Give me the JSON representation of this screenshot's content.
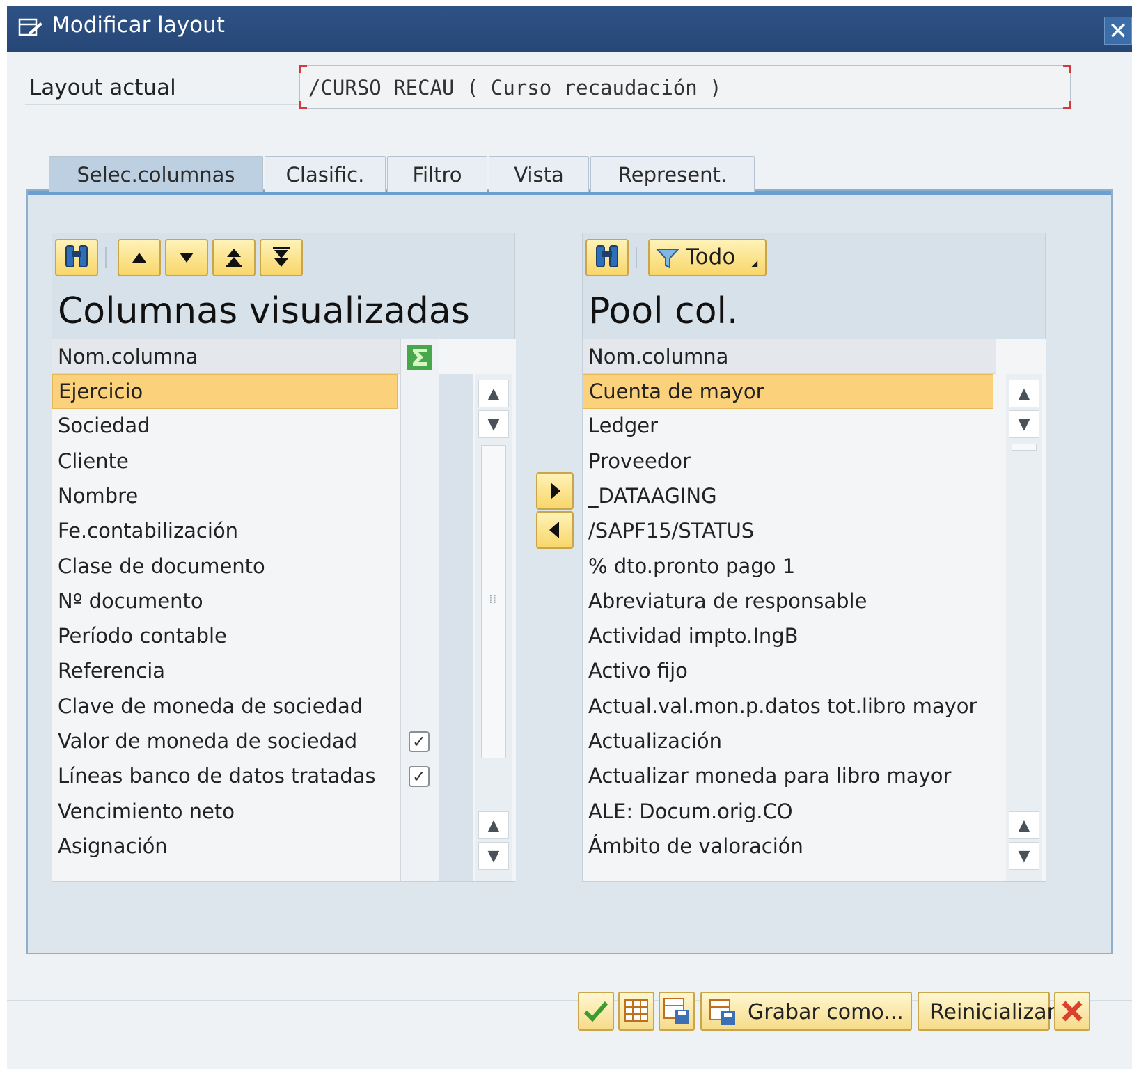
{
  "window": {
    "title": "Modificar layout"
  },
  "layout": {
    "label": "Layout actual",
    "value": "/CURSO RECAU ( Curso recaudación )"
  },
  "tabs": [
    {
      "label": "Selec.columnas",
      "active": true
    },
    {
      "label": "Clasific.",
      "active": false
    },
    {
      "label": "Filtro",
      "active": false
    },
    {
      "label": "Vista",
      "active": false
    },
    {
      "label": "Represent.",
      "active": false
    }
  ],
  "left_panel": {
    "title": "Columnas visualizadas",
    "header": "Nom.columna",
    "sum_icon": "sigma-icon",
    "rows": [
      {
        "label": "Ejercicio",
        "selected": true,
        "checked": false
      },
      {
        "label": "Sociedad",
        "selected": false,
        "checked": false
      },
      {
        "label": "Cliente",
        "selected": false,
        "checked": false
      },
      {
        "label": "Nombre",
        "selected": false,
        "checked": false
      },
      {
        "label": "Fe.contabilización",
        "selected": false,
        "checked": false
      },
      {
        "label": "Clase de documento",
        "selected": false,
        "checked": false
      },
      {
        "label": "Nº documento",
        "selected": false,
        "checked": false
      },
      {
        "label": "Período contable",
        "selected": false,
        "checked": false
      },
      {
        "label": "Referencia",
        "selected": false,
        "checked": false
      },
      {
        "label": "Clave de moneda de sociedad",
        "selected": false,
        "checked": false
      },
      {
        "label": "Valor de moneda de sociedad",
        "selected": false,
        "checked": true
      },
      {
        "label": "Líneas banco de datos tratadas",
        "selected": false,
        "checked": true
      },
      {
        "label": "Vencimiento neto",
        "selected": false,
        "checked": false
      },
      {
        "label": "Asignación",
        "selected": false,
        "checked": false
      }
    ]
  },
  "right_panel": {
    "title": "Pool col.",
    "header": "Nom.columna",
    "filter_label": "Todo",
    "rows": [
      {
        "label": "Cuenta de mayor",
        "selected": true
      },
      {
        "label": "Ledger",
        "selected": false
      },
      {
        "label": "Proveedor",
        "selected": false
      },
      {
        "label": "_DATAAGING",
        "selected": false
      },
      {
        "label": "/SAPF15/STATUS",
        "selected": false
      },
      {
        "label": "% dto.pronto pago 1",
        "selected": false
      },
      {
        "label": "Abreviatura de responsable",
        "selected": false
      },
      {
        "label": "Actividad impto.IngB",
        "selected": false
      },
      {
        "label": "Activo fijo",
        "selected": false
      },
      {
        "label": "Actual.val.mon.p.datos tot.libro mayor",
        "selected": false
      },
      {
        "label": "Actualización",
        "selected": false
      },
      {
        "label": "Actualizar moneda para libro mayor",
        "selected": false
      },
      {
        "label": "ALE: Docum.orig.CO",
        "selected": false
      },
      {
        "label": "Ámbito de valoración",
        "selected": false
      }
    ]
  },
  "buttons": {
    "save_as": "Grabar como...",
    "reset": "Reinicializar"
  },
  "colors": {
    "titlebar": "#264776",
    "selected_row": "#fbd27b",
    "button_face": "#f8d66a"
  }
}
